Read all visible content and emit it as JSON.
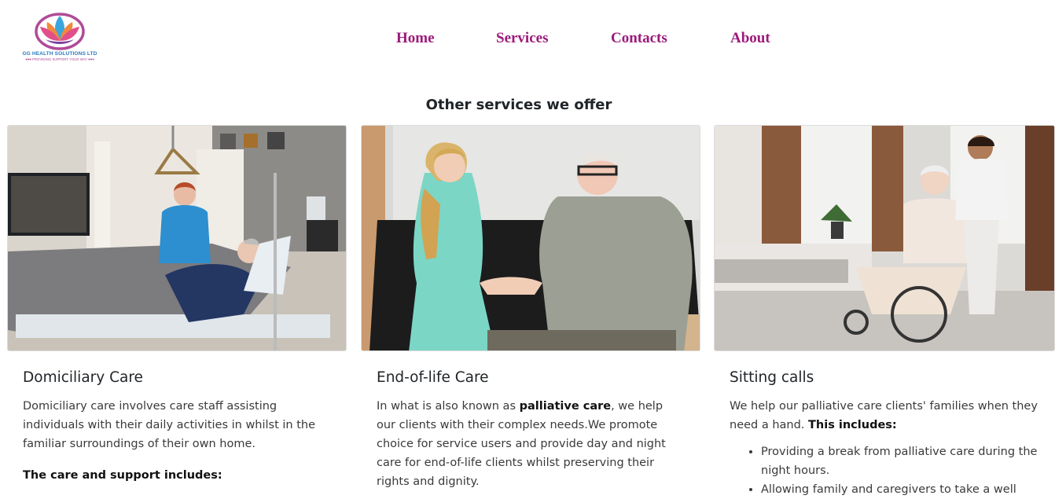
{
  "brand": {
    "name": "GG HEALTH SOLUTIONS LTD",
    "tagline": "♥♥♥ PROVIDING SUPPORT YOUR WAY ♥♥♥",
    "colors": {
      "nav": "#9c1a7a",
      "logo_blue": "#2a7bbf",
      "logo_pink": "#b04b97"
    }
  },
  "nav": {
    "items": [
      {
        "label": "Home"
      },
      {
        "label": "Services"
      },
      {
        "label": "Contacts"
      },
      {
        "label": "About"
      }
    ]
  },
  "section": {
    "title": "Other services we offer"
  },
  "cards": [
    {
      "image_icon": "nurse-with-patient-in-bed-photo",
      "title": "Domiciliary Care",
      "text": "Domiciliary care involves care staff assisting individuals with their daily activities in whilst in the familiar surroundings of their own home.",
      "subheading": "The care and support includes:"
    },
    {
      "image_icon": "nurse-holding-elderly-man-hands-photo",
      "title": "End-of-life Care",
      "text_before": "In what is also known as ",
      "text_bold": "palliative care",
      "text_after": ", we help our clients with their complex needs.We promote choice for service users and provide day and night care for end-of-life clients whilst preserving their rights and dignity."
    },
    {
      "image_icon": "nurse-pushing-wheelchair-photo",
      "title": "Sitting calls",
      "text_before": "We help our palliative care clients' families when they need a hand. ",
      "text_bold": "This includes:",
      "list": [
        "Providing a break from palliative care during the night hours.",
        "Allowing family and caregivers to take a well"
      ]
    }
  ]
}
